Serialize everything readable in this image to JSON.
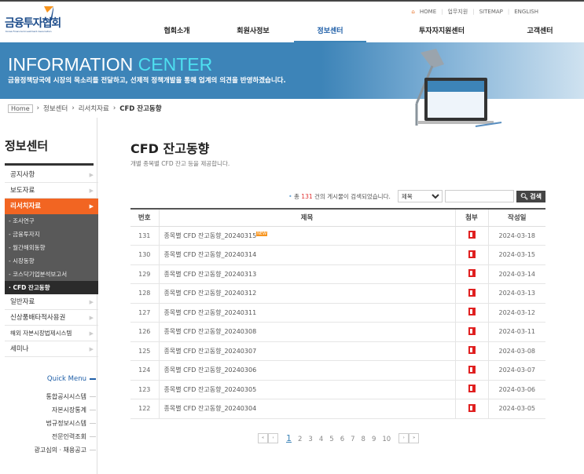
{
  "header": {
    "logo": "금융투자협회",
    "logo_sub": "Korea Financial Investment Association",
    "util": [
      "HOME",
      "업무지원",
      "SITEMAP",
      "ENGLISH"
    ],
    "gnb": [
      "협회소개",
      "회원사정보",
      "정보센터",
      "투자자지원센터",
      "고객센터"
    ]
  },
  "banner": {
    "title_a": "INFORMATION ",
    "title_b": "CENTER",
    "subtitle": "금융정책당국에 시장의 목소리를 전달하고, 선제적 정책개발을 통해 업계의 의견을 반영하겠습니다."
  },
  "breadcrumb": [
    "Home",
    "정보센터",
    "리서치자료",
    "CFD 잔고동향"
  ],
  "sidebar": {
    "title": "정보센터",
    "items_top": [
      "공지사항",
      "보도자료",
      "리서치자료"
    ],
    "sub": [
      "- 조사연구",
      "- 금융투자지",
      "- 월간해외동향",
      "- 시장동향",
      "- 코스닥기업분석보고서",
      "· CFD 잔고동향"
    ],
    "items_bottom": [
      "일반자료",
      "신상품배타적사용권",
      "해외 자본시장법제시스템",
      "세미나"
    ],
    "quick_title": "Quick Menu",
    "quick": [
      "통합공시시스템",
      "자본시장통계",
      "법규정보시스템",
      "전문인력조회",
      "광고심의 · 채용공고"
    ]
  },
  "main": {
    "title": "CFD 잔고동향",
    "desc": "개별 종목별 CFD 잔고 등을 제공합니다.",
    "count_pre": "총 ",
    "count": "131",
    "count_post": " 건의 게시물이 검색되었습니다.",
    "select": "제목",
    "search_btn": "검색",
    "columns": [
      "번호",
      "제목",
      "첨부",
      "작성일"
    ],
    "new_badge": "NEW",
    "rows": [
      [
        "131",
        "종목별 CFD 잔고동향_20240315",
        "2024-03-18"
      ],
      [
        "130",
        "종목별 CFD 잔고동향_20240314",
        "2024-03-15"
      ],
      [
        "129",
        "종목별 CFD 잔고동향_20240313",
        "2024-03-14"
      ],
      [
        "128",
        "종목별 CFD 잔고동향_20240312",
        "2024-03-13"
      ],
      [
        "127",
        "종목별 CFD 잔고동향_20240311",
        "2024-03-12"
      ],
      [
        "126",
        "종목별 CFD 잔고동향_20240308",
        "2024-03-11"
      ],
      [
        "125",
        "종목별 CFD 잔고동향_20240307",
        "2024-03-08"
      ],
      [
        "124",
        "종목별 CFD 잔고동향_20240306",
        "2024-03-07"
      ],
      [
        "123",
        "종목별 CFD 잔고동향_20240305",
        "2024-03-06"
      ],
      [
        "122",
        "종목별 CFD 잔고동향_20240304",
        "2024-03-05"
      ]
    ],
    "pages": [
      "1",
      "2",
      "3",
      "4",
      "5",
      "6",
      "7",
      "8",
      "9",
      "10"
    ],
    "page_nav": [
      "«",
      "‹",
      "›",
      "»"
    ]
  }
}
